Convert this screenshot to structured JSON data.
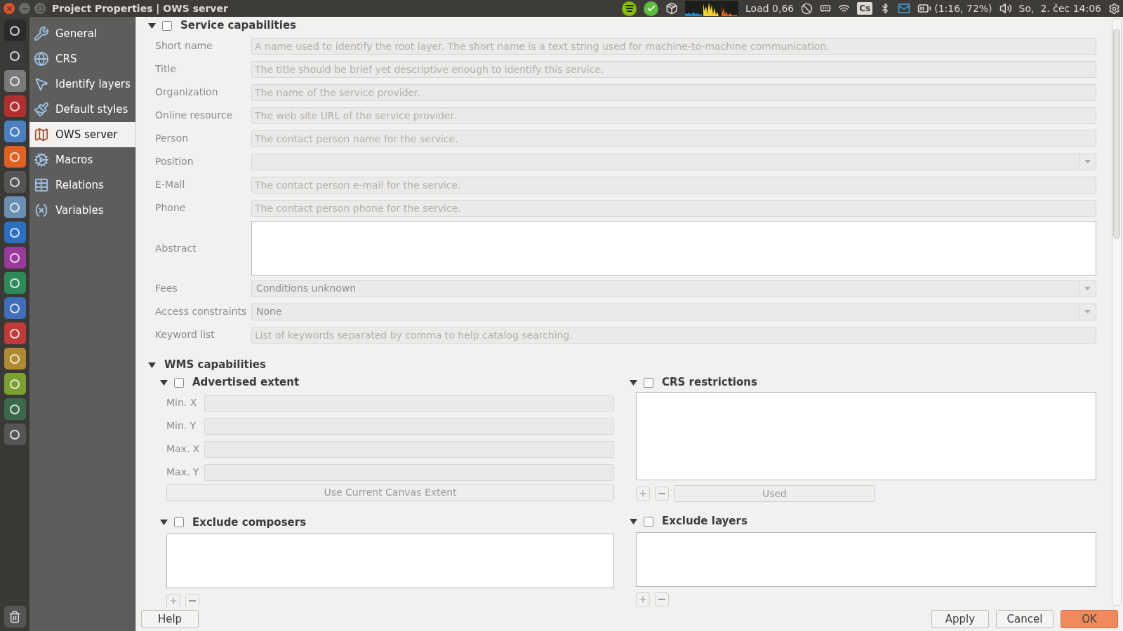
{
  "window": {
    "title": "Project Properties | OWS server"
  },
  "top_bar": {
    "load": "Load 0,66",
    "keyboard": "Cs",
    "battery": "(1:16, 72%)",
    "clock": "So,  2. čec 14:06"
  },
  "sidebar": {
    "items": [
      {
        "label": "General",
        "selected": false
      },
      {
        "label": "CRS",
        "selected": false
      },
      {
        "label": "Identify layers",
        "selected": false
      },
      {
        "label": "Default styles",
        "selected": false
      },
      {
        "label": "OWS server",
        "selected": true
      },
      {
        "label": "Macros",
        "selected": false
      },
      {
        "label": "Relations",
        "selected": false
      },
      {
        "label": "Variables",
        "selected": false
      }
    ]
  },
  "service_capabilities": {
    "title": "Service capabilities",
    "checked": false,
    "expanded": true,
    "disabled": true,
    "fields": [
      {
        "label": "Short name",
        "kind": "text",
        "placeholder": "A name used to identify the root layer. The short name is a text string used for machine-to-machine communication."
      },
      {
        "label": "Title",
        "kind": "text",
        "placeholder": "The title should be brief yet descriptive enough to identify this service."
      },
      {
        "label": "Organization",
        "kind": "text",
        "placeholder": "The name of the service provider."
      },
      {
        "label": "Online resource",
        "kind": "text",
        "placeholder": "The web site URL of the service provider."
      },
      {
        "label": "Person",
        "kind": "text",
        "placeholder": "The contact person name for the service."
      },
      {
        "label": "Position",
        "kind": "combo"
      },
      {
        "label": "E-Mail",
        "kind": "text",
        "placeholder": "The contact person e-mail for the service."
      },
      {
        "label": "Phone",
        "kind": "text",
        "placeholder": "The contact person phone for the service."
      },
      {
        "label": "Abstract",
        "kind": "textarea"
      },
      {
        "label": "Fees",
        "kind": "combo",
        "value": "Conditions unknown"
      },
      {
        "label": "Access constraints",
        "kind": "combo",
        "value": "None"
      },
      {
        "label": "Keyword list",
        "kind": "text",
        "placeholder": "List of keywords separated by comma to help catalog searching."
      }
    ]
  },
  "wms_capabilities": {
    "title": "WMS capabilities",
    "expanded": true,
    "advertised_extent": {
      "title": "Advertised extent",
      "checked": false,
      "expanded": true,
      "disabled": true,
      "fields": [
        {
          "label": "Min. X"
        },
        {
          "label": "Min. Y"
        },
        {
          "label": "Max. X"
        },
        {
          "label": "Max. Y"
        }
      ],
      "button": "Use Current Canvas Extent"
    },
    "crs_restrictions": {
      "title": "CRS restrictions",
      "checked": false,
      "expanded": true,
      "button": "Used"
    },
    "exclude_composers": {
      "title": "Exclude composers",
      "checked": false,
      "expanded": true
    },
    "exclude_layers": {
      "title": "Exclude layers",
      "checked": false,
      "expanded": true
    }
  },
  "buttons": [
    {
      "label": "Help",
      "default": false
    },
    {
      "label": "Apply",
      "default": false
    },
    {
      "label": "Cancel",
      "default": false
    },
    {
      "label": "OK",
      "default": true
    }
  ]
}
